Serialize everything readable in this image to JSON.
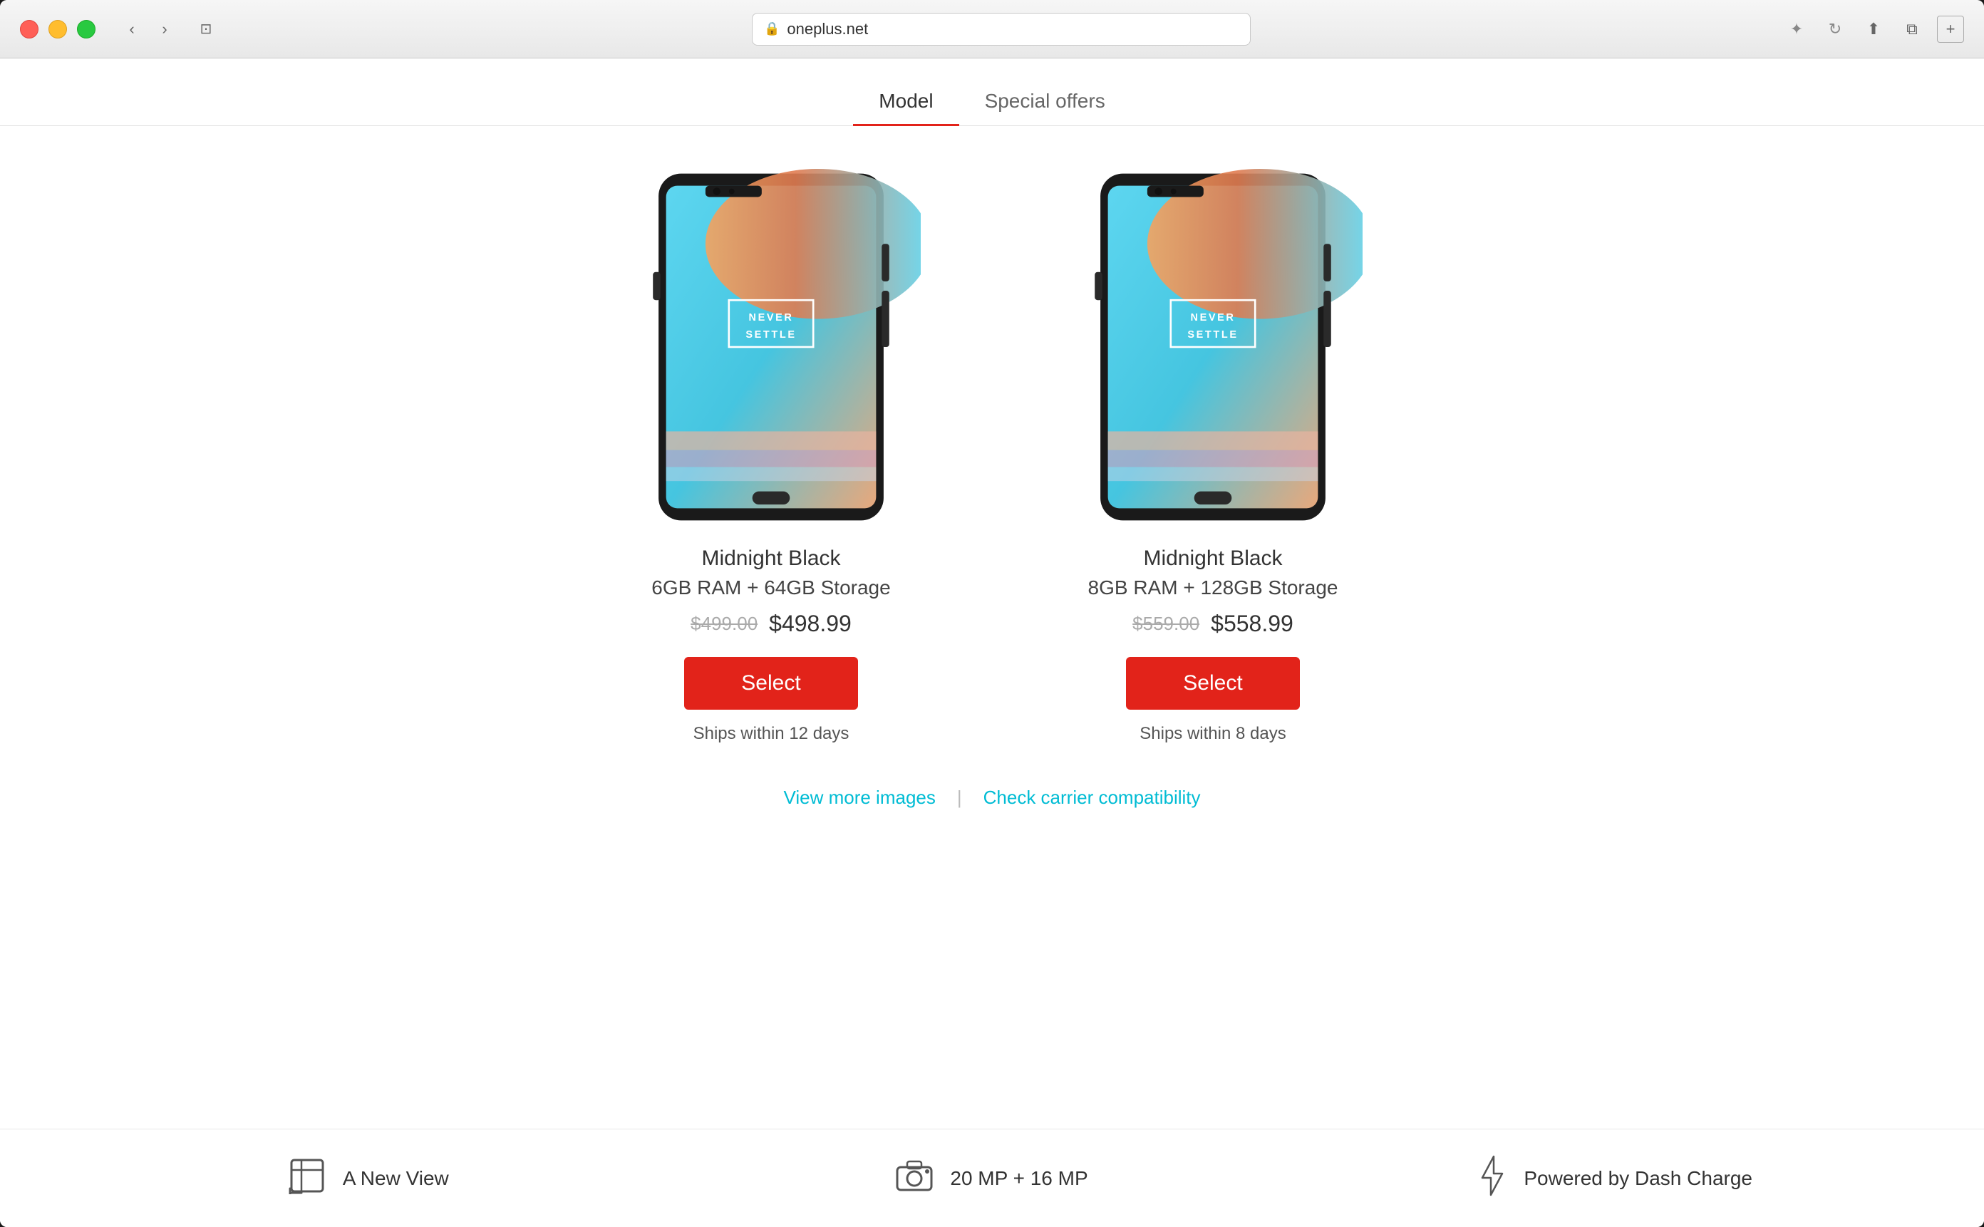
{
  "browser": {
    "url": "oneplus.net",
    "star_icon": "✦",
    "refresh_icon": "↻",
    "back_icon": "‹",
    "forward_icon": "›",
    "sidebar_icon": "⊡",
    "share_icon": "↑",
    "tabview_icon": "⧉",
    "plus_icon": "+"
  },
  "tabs": [
    {
      "label": "Model",
      "active": true
    },
    {
      "label": "Special offers",
      "active": false
    }
  ],
  "products": [
    {
      "id": "product-1",
      "name": "Midnight Black",
      "storage": "6GB RAM + 64GB Storage",
      "price_old": "$499.00",
      "price_new": "$498.99",
      "select_label": "Select",
      "ships": "Ships within 12 days"
    },
    {
      "id": "product-2",
      "name": "Midnight Black",
      "storage": "8GB RAM + 128GB Storage",
      "price_old": "$559.00",
      "price_new": "$558.99",
      "select_label": "Select",
      "ships": "Ships within 8 days"
    }
  ],
  "links": {
    "view_images": "View more images",
    "check_carrier": "Check carrier compatibility",
    "divider": "|"
  },
  "features": [
    {
      "icon": "frame",
      "text": "A New View"
    },
    {
      "icon": "camera",
      "text": "20 MP + 16 MP"
    },
    {
      "icon": "bolt",
      "text": "Powered by Dash Charge"
    }
  ],
  "never_settle_text": "NEVER SETTLE"
}
